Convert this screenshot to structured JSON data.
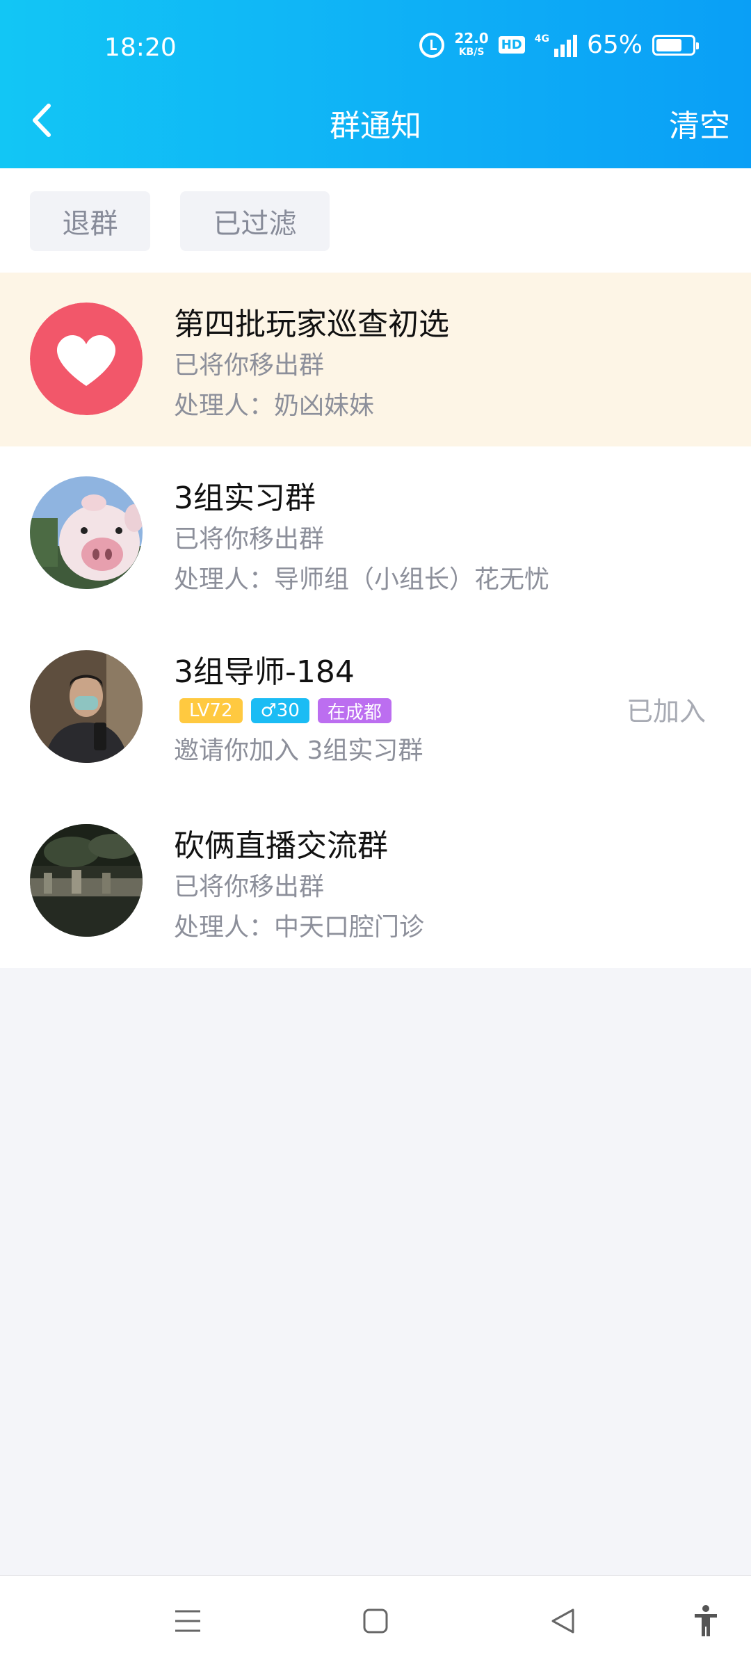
{
  "status_bar": {
    "time": "18:20",
    "net_speed_value": "22.0",
    "net_speed_unit": "KB/S",
    "hd": "HD",
    "network": "4G",
    "battery_percent": "65%"
  },
  "nav": {
    "title": "群通知",
    "clear_label": "清空"
  },
  "filters": [
    "退群",
    "已过滤"
  ],
  "notifications": [
    {
      "title": "第四批玩家巡查初选",
      "line1": "已将你移出群",
      "line2": "处理人：奶凶妹妹"
    },
    {
      "title": "3组实习群",
      "line1": "已将你移出群",
      "line2": "处理人：导师组（小组长）花无忧"
    },
    {
      "title": "3组导师-184",
      "tags": [
        "LV72",
        "♂30",
        "在成都"
      ],
      "line2": "邀请你加入 3组实习群",
      "status": "已加入"
    },
    {
      "title": "砍俩直播交流群",
      "line1": "已将你移出群",
      "line2": "处理人：中天口腔门诊"
    }
  ],
  "colors": {
    "header_gradient_start": "#12c6f5",
    "header_gradient_end": "#0a9ff6",
    "highlight_row": "#fdf5e6",
    "heart_avatar_bg": "#f2576a",
    "tag_level": "#ffc940",
    "tag_gender": "#1bbcf4",
    "tag_location": "#bc6ef0"
  },
  "icons": {
    "back": "chevron-left-icon",
    "alarm": "alarm-clock-icon",
    "menu": "menu-icon",
    "home": "home-square-icon",
    "back_nav": "back-triangle-icon",
    "accessibility": "accessibility-icon"
  }
}
